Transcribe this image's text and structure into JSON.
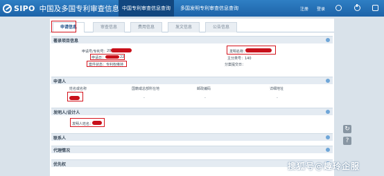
{
  "header": {
    "logo": "SIPO",
    "site_title": "中国及多国专利审查信息查询",
    "nav_tabs": [
      "中国专利审查信息查询",
      "多国发明专利审查信息查询"
    ],
    "links": [
      "注册",
      "登录"
    ],
    "icons": [
      "gear-icon",
      "power-icon",
      "lock-icon"
    ]
  },
  "tabs": [
    "申请信息",
    "审查信息",
    "费用信息",
    "发文信息",
    "公告信息"
  ],
  "sections": {
    "basic": "著录项目信息",
    "applicant": "申请人",
    "inventor": "发明人/设计人",
    "contact": "联系人",
    "agency": "代理情况",
    "priority": "优先权"
  },
  "basic_fields": {
    "app_no_label": "申请号/专利号：",
    "app_no_partial": "20",
    "app_date_label": "申请日：",
    "app_date_partial": "22",
    "case_status": "案件状态：专利权维持",
    "invention_name_label": "发明名称：",
    "main_class": "主分类号：140",
    "division_date_label": "分案提交日："
  },
  "applicant_table": {
    "columns": [
      "姓名或名称",
      "国籍或总部所在地",
      "邮政编码",
      "详细地址"
    ],
    "row": [
      "",
      "-",
      "-",
      "-"
    ]
  },
  "inventor_field": "发明人姓名：",
  "side_buttons": [
    "↻",
    "?"
  ],
  "watermark": "搜狐号@趣玲企服"
}
